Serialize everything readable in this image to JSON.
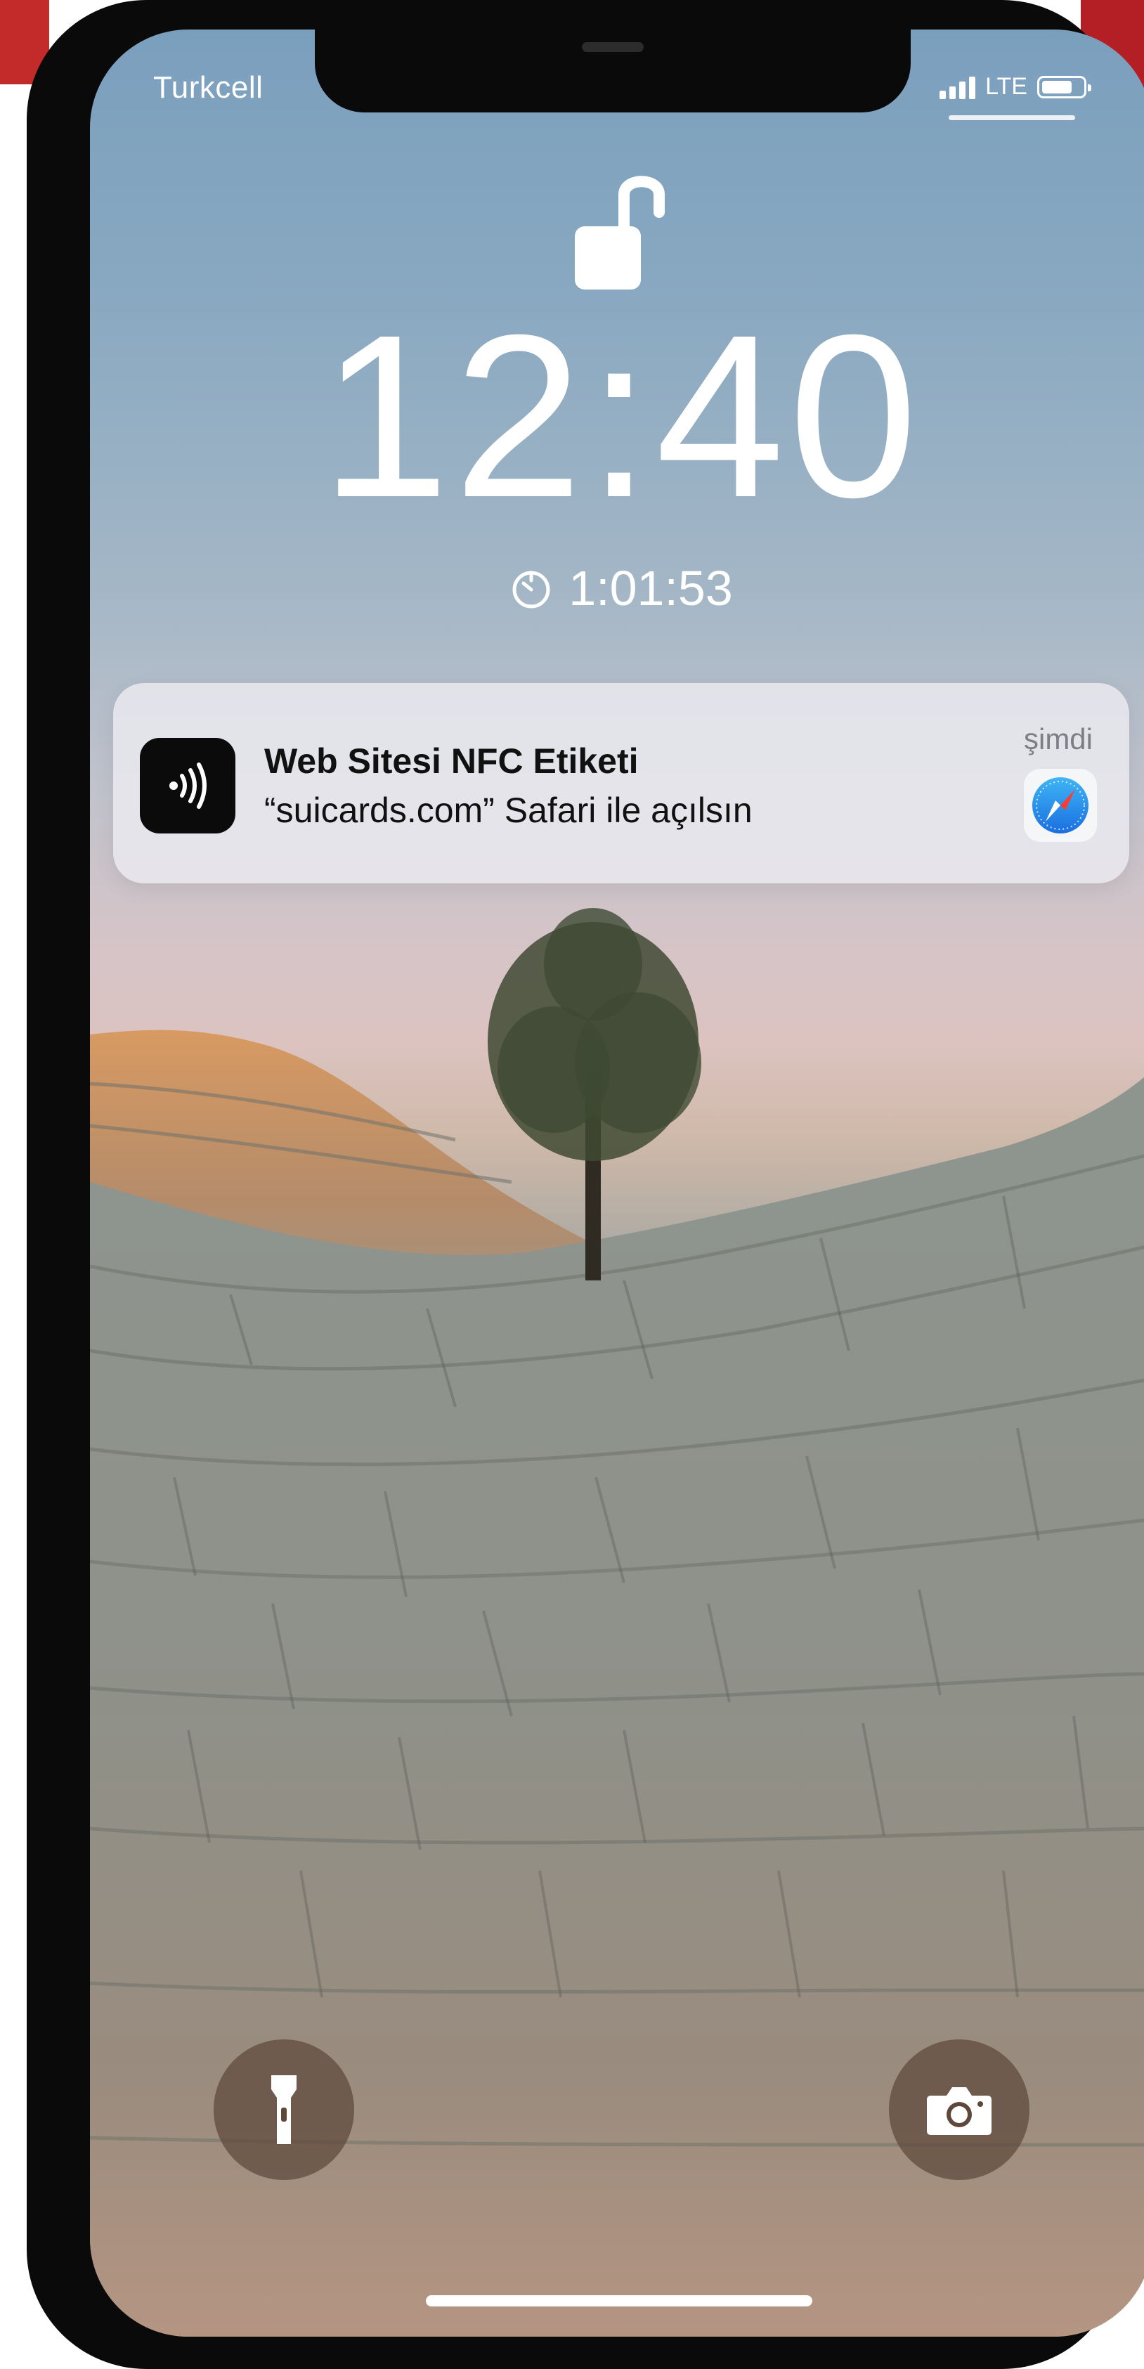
{
  "status_bar": {
    "carrier": "Turkcell",
    "network": "LTE",
    "signal_bars": 4,
    "battery_level": 0.6
  },
  "lock_screen": {
    "lock_state": "unlocked",
    "time": "12:40",
    "timer_icon": "timer-icon",
    "timer_value": "1:01:53"
  },
  "notification": {
    "app_icon": "nfc-icon",
    "title": "Web Sitesi NFC Etiketi",
    "body": "“suicards.com” Safari ile açılsın",
    "timestamp": "şimdi",
    "action_icon": "safari-icon"
  },
  "quick_actions": {
    "left_icon": "flashlight-icon",
    "right_icon": "camera-icon"
  },
  "colors": {
    "sky_top": "#7a9fbd",
    "sky_horizon": "#dcc3c0",
    "rock": "#8f958e",
    "button_bg": "#5d483a",
    "notification_bg": "#ebecf0"
  }
}
